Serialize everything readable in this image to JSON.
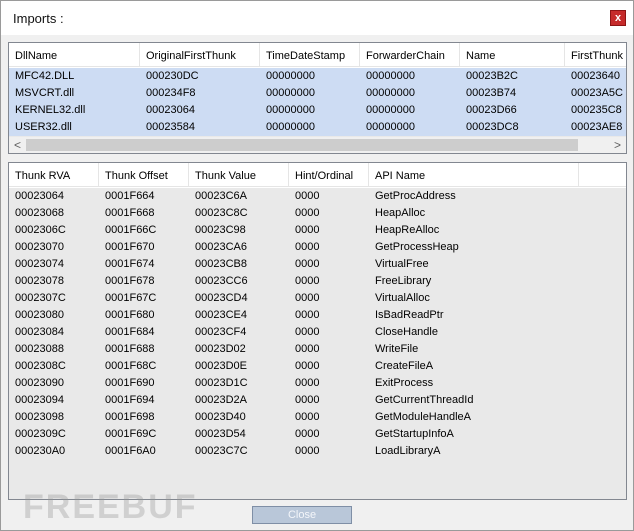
{
  "window": {
    "title": "Imports :",
    "close_glyph": "x"
  },
  "dll_table": {
    "columns": [
      "DllName",
      "OriginalFirstThunk",
      "TimeDateStamp",
      "ForwarderChain",
      "Name",
      "FirstThunk"
    ],
    "rows": [
      [
        "MFC42.DLL",
        "000230DC",
        "00000000",
        "00000000",
        "00023B2C",
        "00023640"
      ],
      [
        "MSVCRT.dll",
        "000234F8",
        "00000000",
        "00000000",
        "00023B74",
        "00023A5C"
      ],
      [
        "KERNEL32.dll",
        "00023064",
        "00000000",
        "00000000",
        "00023D66",
        "000235C8"
      ],
      [
        "USER32.dll",
        "00023584",
        "00000000",
        "00000000",
        "00023DC8",
        "00023AE8"
      ]
    ],
    "scroll_left_glyph": "<",
    "scroll_right_glyph": ">"
  },
  "thunk_table": {
    "columns": [
      "Thunk RVA",
      "Thunk Offset",
      "Thunk Value",
      "Hint/Ordinal",
      "API Name"
    ],
    "rows": [
      [
        "00023064",
        "0001F664",
        "00023C6A",
        "0000",
        "GetProcAddress"
      ],
      [
        "00023068",
        "0001F668",
        "00023C8C",
        "0000",
        "HeapAlloc"
      ],
      [
        "0002306C",
        "0001F66C",
        "00023C98",
        "0000",
        "HeapReAlloc"
      ],
      [
        "00023070",
        "0001F670",
        "00023CA6",
        "0000",
        "GetProcessHeap"
      ],
      [
        "00023074",
        "0001F674",
        "00023CB8",
        "0000",
        "VirtualFree"
      ],
      [
        "00023078",
        "0001F678",
        "00023CC6",
        "0000",
        "FreeLibrary"
      ],
      [
        "0002307C",
        "0001F67C",
        "00023CD4",
        "0000",
        "VirtualAlloc"
      ],
      [
        "00023080",
        "0001F680",
        "00023CE4",
        "0000",
        "IsBadReadPtr"
      ],
      [
        "00023084",
        "0001F684",
        "00023CF4",
        "0000",
        "CloseHandle"
      ],
      [
        "00023088",
        "0001F688",
        "00023D02",
        "0000",
        "WriteFile"
      ],
      [
        "0002308C",
        "0001F68C",
        "00023D0E",
        "0000",
        "CreateFileA"
      ],
      [
        "00023090",
        "0001F690",
        "00023D1C",
        "0000",
        "ExitProcess"
      ],
      [
        "00023094",
        "0001F694",
        "00023D2A",
        "0000",
        "GetCurrentThreadId"
      ],
      [
        "00023098",
        "0001F698",
        "00023D40",
        "0000",
        "GetModuleHandleA"
      ],
      [
        "0002309C",
        "0001F69C",
        "00023D54",
        "0000",
        "GetStartupInfoA"
      ],
      [
        "000230A0",
        "0001F6A0",
        "00023C7C",
        "0000",
        "LoadLibraryA"
      ]
    ]
  },
  "footer": {
    "close_label": "Close",
    "watermark": "FREEBUF"
  }
}
